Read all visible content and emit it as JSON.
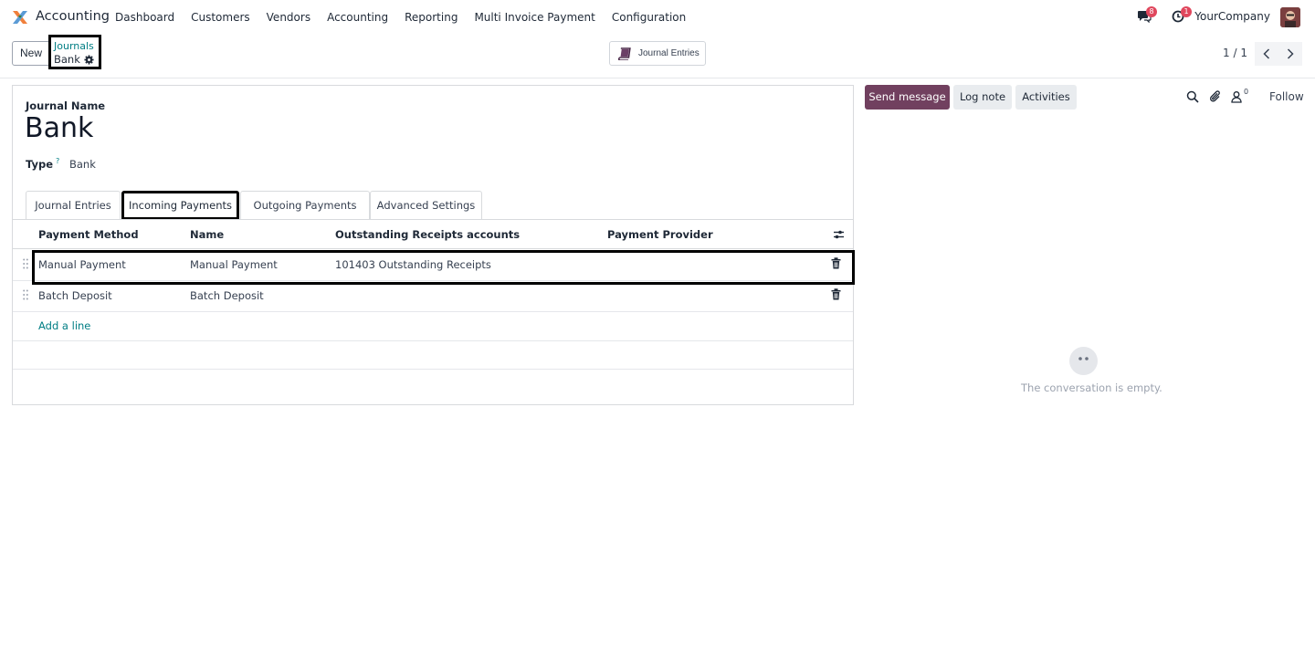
{
  "navbar": {
    "app_name": "Accounting",
    "menu": [
      "Dashboard",
      "Customers",
      "Vendors",
      "Accounting",
      "Reporting",
      "Multi Invoice Payment",
      "Configuration"
    ],
    "messages_badge": "8",
    "activities_badge": "1",
    "company": "YourCompany"
  },
  "control": {
    "new_label": "New",
    "breadcrumb_parent": "Journals",
    "breadcrumb_current": "Bank",
    "smart_button_label": "Journal Entries",
    "pager": "1 / 1"
  },
  "form": {
    "journal_name_label": "Journal Name",
    "journal_name": "Bank",
    "type_label": "Type",
    "type_help": "?",
    "type_value": "Bank"
  },
  "tabs": [
    "Journal Entries",
    "Incoming Payments",
    "Outgoing Payments",
    "Advanced Settings"
  ],
  "table": {
    "headers": [
      "Payment Method",
      "Name",
      "Outstanding Receipts accounts",
      "Payment Provider"
    ],
    "rows": [
      {
        "method": "Manual Payment",
        "name": "Manual Payment",
        "account": "101403 Outstanding Receipts",
        "provider": ""
      },
      {
        "method": "Batch Deposit",
        "name": "Batch Deposit",
        "account": "",
        "provider": ""
      }
    ],
    "add_line": "Add a line"
  },
  "chatter": {
    "send_message": "Send message",
    "log_note": "Log note",
    "activities": "Activities",
    "followers_count": "0",
    "follow": "Follow",
    "empty_text": "The conversation is empty."
  },
  "colors": {
    "brand": "#71405f",
    "link": "#017e84",
    "badge": "#e0475d"
  }
}
